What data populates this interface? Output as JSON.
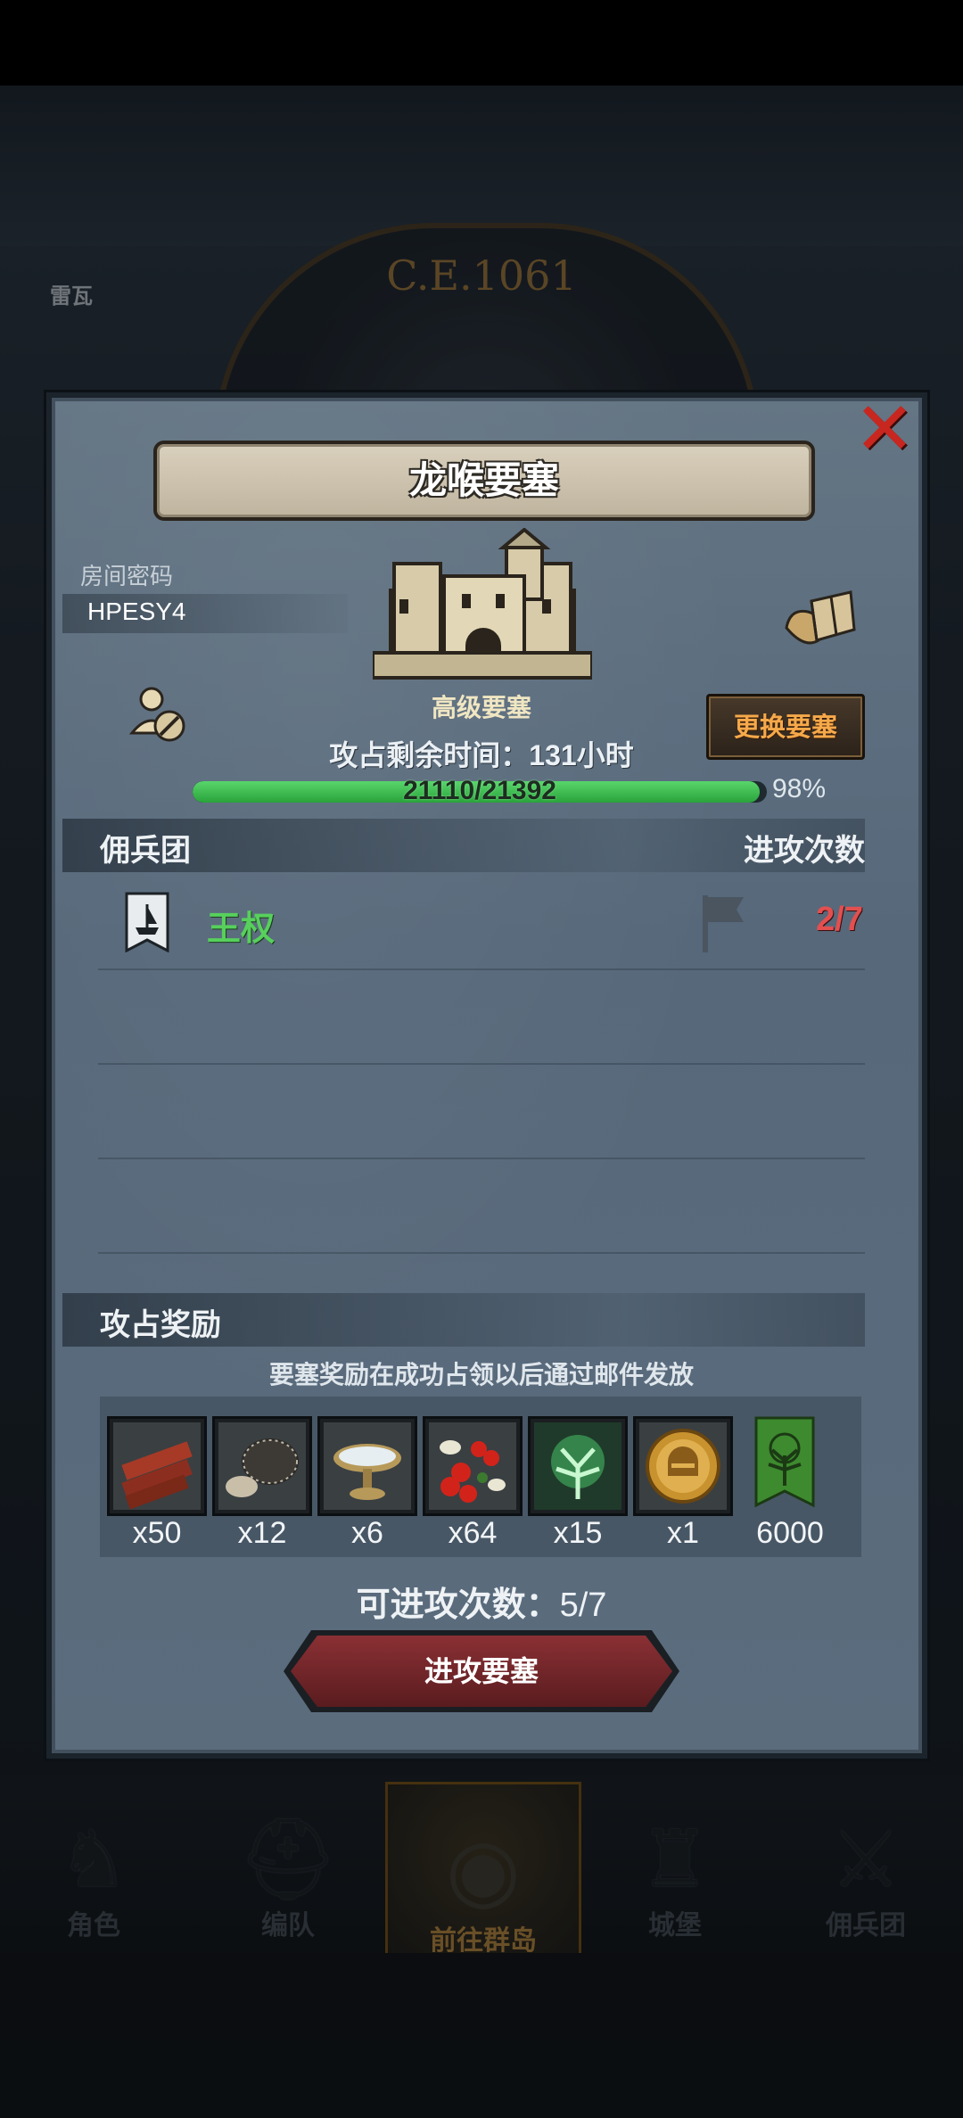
{
  "background": {
    "era_label": "C.E.1061",
    "left_label": "雷瓦"
  },
  "dialog": {
    "title": "龙喉要塞",
    "room_label": "房间密码",
    "room_code": "HPESY4",
    "fortress_name": "高级要塞",
    "remaining_prefix": "攻占剩余时间：",
    "remaining_value": "131",
    "remaining_unit": "小时",
    "change_button": "更换要塞",
    "progress": {
      "text": "21110/21392",
      "percent_label": "98%",
      "fraction": 0.987
    },
    "mercenary_section": {
      "left_header": "佣兵团",
      "right_header": "进攻次数",
      "rows": [
        {
          "name": "王权",
          "count": "2/7"
        }
      ]
    },
    "reward_section": {
      "header": "攻占奖励",
      "note": "要塞奖励在成功占领以后通过邮件发放",
      "items": [
        {
          "icon": "wood-planks-icon",
          "qty": "x50"
        },
        {
          "icon": "stone-ore-icon",
          "qty": "x12"
        },
        {
          "icon": "silver-chalice-icon",
          "qty": "x6"
        },
        {
          "icon": "red-berries-icon",
          "qty": "x64"
        },
        {
          "icon": "green-tree-spirit-icon",
          "qty": "x15"
        },
        {
          "icon": "gold-helmet-medal-icon",
          "qty": "x1"
        },
        {
          "icon": "green-tree-banner-icon",
          "qty": "6000"
        }
      ]
    },
    "attack_count_prefix": "可进攻次数：",
    "attack_count_value": "5/7",
    "attack_button": "进攻要塞"
  },
  "bottom_nav": [
    {
      "label": "角色",
      "icon": "knight-icon"
    },
    {
      "label": "编队",
      "icon": "helmet-icon"
    },
    {
      "label": "前往群岛",
      "icon": "globe-icon",
      "active": true
    },
    {
      "label": "城堡",
      "icon": "castle-icon"
    },
    {
      "label": "佣兵团",
      "icon": "mercenary-icon"
    }
  ]
}
